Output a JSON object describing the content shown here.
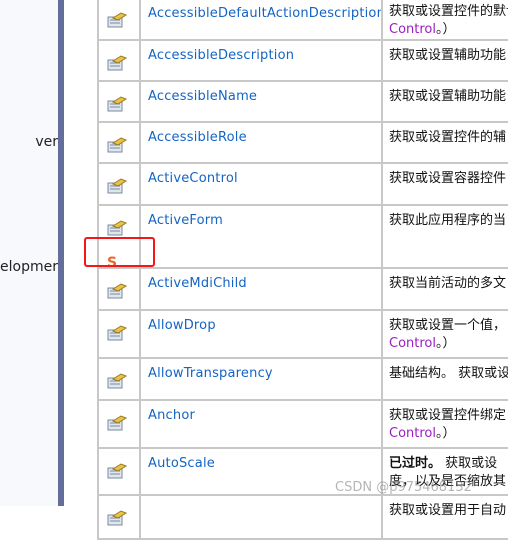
{
  "sidebar": {
    "items": [
      {
        "label": "ver"
      },
      {
        "label": "elopmer"
      }
    ]
  },
  "table": {
    "rows": [
      {
        "name": "AccessibleDefaultActionDescription",
        "desc": "获取或设置控件的默认",
        "desc2": "Control",
        "desc2_suffix": "。）",
        "icon": "property-icon"
      },
      {
        "name": "AccessibleDescription",
        "desc": "获取或设置辅助功能",
        "icon": "property-icon"
      },
      {
        "name": "AccessibleName",
        "desc": "获取或设置辅助功能",
        "icon": "property-icon"
      },
      {
        "name": "AccessibleRole",
        "desc": "获取或设置控件的辅",
        "icon": "property-icon"
      },
      {
        "name": "ActiveControl",
        "desc": "获取或设置容器控件",
        "icon": "property-icon"
      },
      {
        "name": "ActiveForm",
        "desc": "获取此应用程序的当",
        "icon": "property-icon",
        "static_badge": "S"
      },
      {
        "name": "ActiveMdiChild",
        "desc": "获取当前活动的多文",
        "icon": "property-icon"
      },
      {
        "name": "AllowDrop",
        "desc": "获取或设置一个值，",
        "desc2": "Control",
        "desc2_suffix": "。）",
        "icon": "property-icon"
      },
      {
        "name": "AllowTransparency",
        "desc": "基础结构。 获取或设",
        "icon": "property-icon"
      },
      {
        "name": "Anchor",
        "desc": "获取或设置控件绑定",
        "desc2": "Control",
        "desc2_suffix": "。）",
        "icon": "property-icon"
      },
      {
        "name": "AutoScale",
        "desc_bold": "已过时。",
        "desc": " 获取或设",
        "desc_line2": "度，以及是否缩放其",
        "icon": "property-icon"
      },
      {
        "name": "",
        "desc": "获取或设置用于自动",
        "icon": "property-icon"
      }
    ]
  },
  "watermark": "CSDN @p975468132",
  "colors": {
    "link": "#1364c4",
    "control_link": "#9b1fc0",
    "highlight_box": "#f01818",
    "sidebar_bar": "#636e9a"
  }
}
